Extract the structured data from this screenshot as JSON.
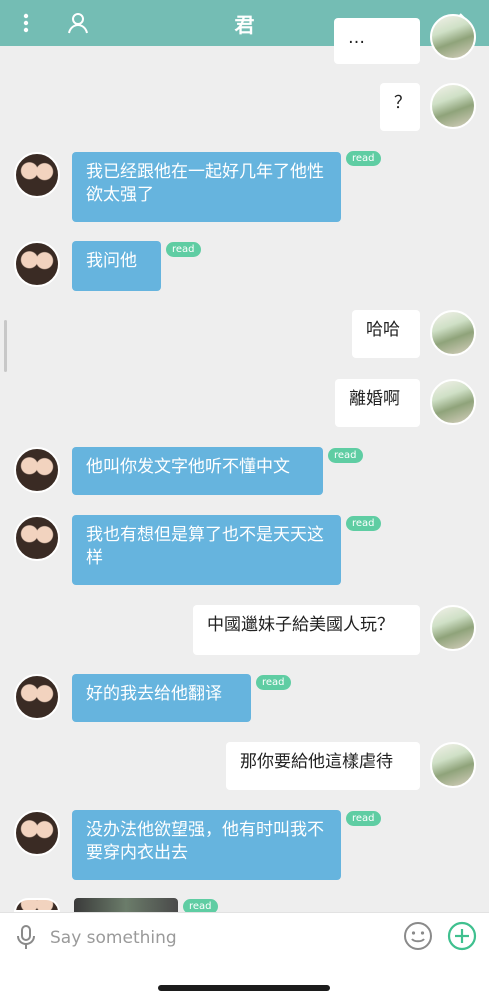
{
  "header": {
    "title": "君"
  },
  "messages": [
    {
      "text": "…",
      "read": ""
    },
    {
      "text": "？",
      "read": ""
    },
    {
      "text": "我已经跟他在一起好几年了他性欲太强了",
      "read": "read"
    },
    {
      "text": "我问他",
      "read": "read"
    },
    {
      "text": "哈哈",
      "read": ""
    },
    {
      "text": "離婚啊",
      "read": ""
    },
    {
      "text": "他叫你发文字他听不懂中文",
      "read": "read"
    },
    {
      "text": "我也有想但是算了也不是天天这样",
      "read": "read"
    },
    {
      "text": "中國邋妹子給美國人玩？",
      "read": ""
    },
    {
      "text": "好的我去给他翻译",
      "read": "read"
    },
    {
      "text": "那你要給他這樣虐待",
      "read": ""
    },
    {
      "text": "没办法他欲望强，他有时叫我不要穿内衣出去",
      "read": "read"
    },
    {
      "text": "",
      "read": "read"
    }
  ],
  "input": {
    "placeholder": "Say something"
  },
  "colors": {
    "header": "#74bdb4",
    "bubble_blue": "#66b4de",
    "read_badge": "#5fcda3",
    "plus": "#3fc08f"
  },
  "icons": {
    "menu": "more-vertical-icon",
    "profile": "user-icon",
    "next": "chevron-right-icon",
    "mic": "microphone-icon",
    "emoji": "smiley-icon",
    "add": "plus-circle-icon"
  }
}
